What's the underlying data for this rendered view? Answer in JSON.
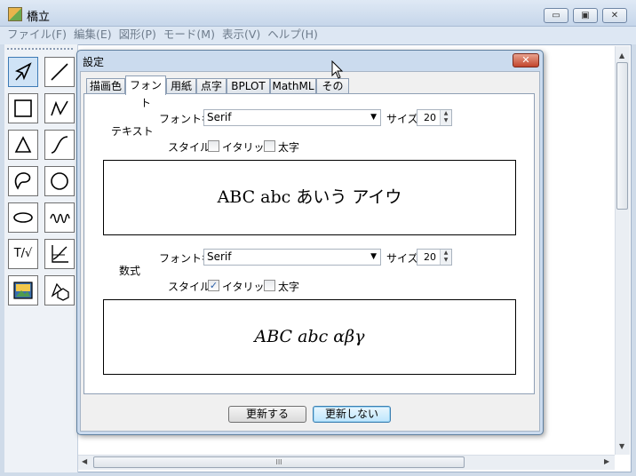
{
  "window": {
    "title": "橋立",
    "buttons": [
      "▭",
      "▣",
      "✕"
    ]
  },
  "menu": [
    "ファイル(F)",
    "編集(E)",
    "図形(P)",
    "モード(M)",
    "表示(V)",
    "ヘルプ(H)"
  ],
  "tools": [
    {
      "name": "select-arrow-icon",
      "active": true
    },
    {
      "name": "line-icon"
    },
    {
      "name": "rectangle-icon"
    },
    {
      "name": "polyline-icon"
    },
    {
      "name": "triangle-icon"
    },
    {
      "name": "curve-icon"
    },
    {
      "name": "freeform-shape-icon"
    },
    {
      "name": "circle-icon"
    },
    {
      "name": "ellipse-icon"
    },
    {
      "name": "wave-icon"
    },
    {
      "name": "text-math-icon",
      "text": "T/√"
    },
    {
      "name": "graph-axes-icon"
    },
    {
      "name": "image-icon"
    },
    {
      "name": "solid-shape-icon"
    }
  ],
  "dialog": {
    "title": "設定",
    "close": "✕",
    "tabs": [
      "描画色",
      "フォント",
      "用紙",
      "点字",
      "BPLOT",
      "MathML",
      "その他"
    ],
    "active_tab": "フォント",
    "text_section": {
      "heading": "テキスト",
      "font_label": "フォント名",
      "font_value": "Serif",
      "size_label": "サイズ",
      "size_value": "20",
      "style_label": "スタイル",
      "italic_label": "イタリック",
      "italic_checked": false,
      "bold_label": "太字",
      "bold_checked": false,
      "preview": "ABC abc あいう アイウ"
    },
    "math_section": {
      "heading": "数式",
      "font_label": "フォント名",
      "font_value": "Serif",
      "size_label": "サイズ",
      "size_value": "20",
      "style_label": "スタイル",
      "italic_label": "イタリック",
      "italic_checked": true,
      "bold_label": "太字",
      "bold_checked": false,
      "preview": "ABC abc αβγ"
    },
    "buttons": {
      "update": "更新する",
      "no_update": "更新しない"
    }
  },
  "scrollbar": {
    "grip": "III"
  }
}
